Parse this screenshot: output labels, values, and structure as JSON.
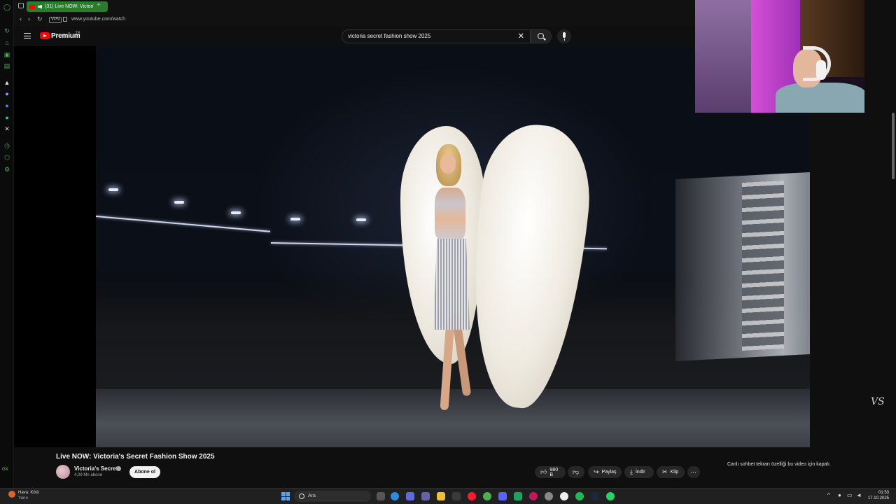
{
  "browser": {
    "tab_title": "(31) Live NOW: Victori",
    "url": "www.youtube.com/watch",
    "vpn_label": "VPN",
    "gx_label": "GX"
  },
  "youtube": {
    "brand": "Premium",
    "country_code": "TR",
    "search_value": "victoria secret fashion show 2025"
  },
  "video": {
    "title": "Live NOW: Victoria's Secret Fashion Show 2025",
    "channel_name": "Victoria's Secret",
    "subscribers": "4,09 Mn abone",
    "subscribe_label": "Abone ol",
    "likes": "980 B",
    "share_label": "Paylaş",
    "download_label": "İndir",
    "clip_label": "Klip",
    "watermark": "VS"
  },
  "chat": {
    "disabled_message": "Canlı sohbet tekrarı özelliği bu video için kapalı."
  },
  "taskbar": {
    "weather_title": "Hava: Kötü",
    "weather_sub": "Yarın",
    "search_placeholder": "Ara",
    "time": "01:53",
    "date": "17.10.2025"
  },
  "colors": {
    "youtube_red": "#ff0000",
    "opera_green": "#2c7a2c",
    "windows_blue": "#4ea6ff"
  }
}
